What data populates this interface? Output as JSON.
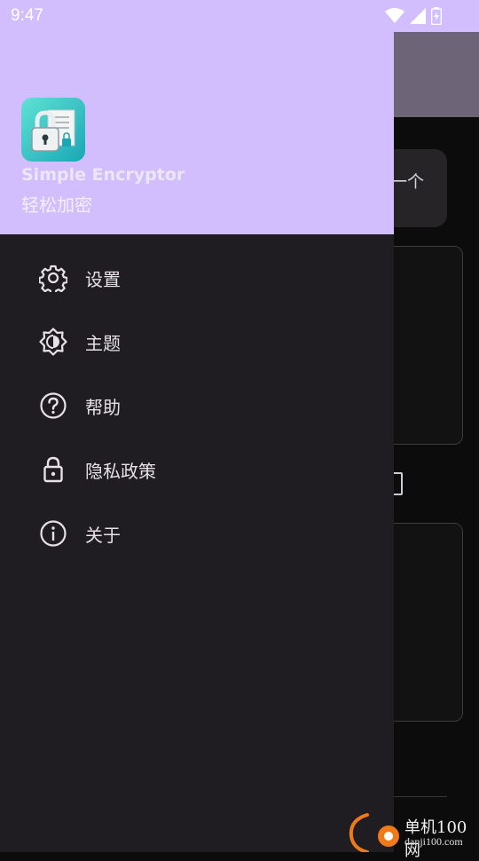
{
  "status_bar": {
    "time": "9:47",
    "icons": [
      "wifi-icon",
      "signal-icon",
      "battery-charging-icon"
    ]
  },
  "background_app": {
    "chip_text": "一个"
  },
  "drawer": {
    "app_name": "Simple Encryptor",
    "app_subtitle": "轻松加密",
    "header_color": "#d2befd",
    "items": [
      {
        "label": "设置",
        "icon": "gear-icon"
      },
      {
        "label": "主题",
        "icon": "theme-brightness-icon"
      },
      {
        "label": "帮助",
        "icon": "help-circle-icon"
      },
      {
        "label": "隐私政策",
        "icon": "lock-icon"
      },
      {
        "label": "关于",
        "icon": "info-icon"
      }
    ]
  },
  "watermark": {
    "title": "单机100网",
    "url": "danji100.com"
  }
}
